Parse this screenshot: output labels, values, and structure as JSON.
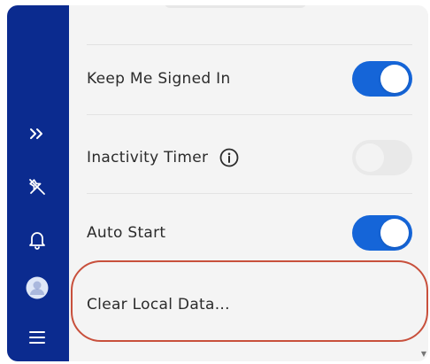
{
  "sidebar": {
    "items": [
      {
        "icon": "double-chevron-right-icon"
      },
      {
        "icon": "unpin-icon"
      },
      {
        "icon": "bell-icon"
      },
      {
        "icon": "user-avatar-icon"
      },
      {
        "icon": "hamburger-menu-icon"
      }
    ]
  },
  "settings": {
    "keep_signed_in": {
      "label": "Keep Me Signed In",
      "enabled": true
    },
    "inactivity_timer": {
      "label": "Inactivity Timer",
      "enabled": false,
      "info_icon": "info-icon"
    },
    "auto_start": {
      "label": "Auto Start",
      "enabled": true
    },
    "clear_local_data": {
      "label": "Clear Local Data..."
    }
  },
  "colors": {
    "sidebar": "#0b2b8f",
    "toggle_on": "#1565d8",
    "toggle_off": "#e9e9e9",
    "highlight": "#c8503c",
    "panel_bg": "#f4f4f4"
  },
  "scrollbar": {
    "down_arrow": "▼"
  }
}
